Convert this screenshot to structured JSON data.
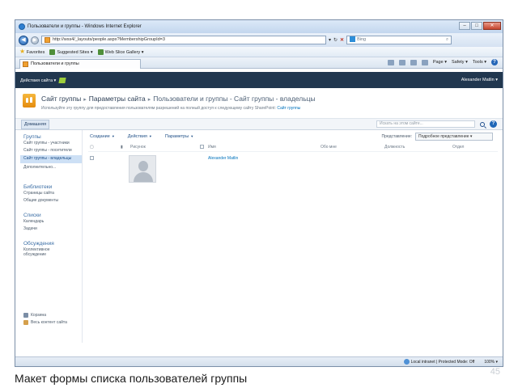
{
  "browser": {
    "title": "Пользователи и группы - Windows Internet Explorer",
    "url": "http://wss4/_layouts/people.aspx?MembershipGroupId=3",
    "search_placeholder": "Bing",
    "favorites": "Favorites",
    "suggested_sites": "Suggested Sites ▾",
    "web_slice": "Web Slice Gallery ▾",
    "tab_title": "Пользователи и группы",
    "cmd_page": "Page ▾",
    "cmd_safety": "Safety ▾",
    "cmd_tools": "Tools ▾",
    "status_zone": "Local intranet | Protected Mode: Off",
    "zoom": "100% ▾"
  },
  "sp": {
    "site_actions": "Действия сайта ▾",
    "user": "Alexander Matlin ▾",
    "breadcrumb": [
      "Сайт группы",
      "Параметры сайта",
      "Пользователи и группы - Сайт группы - владельцы"
    ],
    "description_text": "Используйте эту группу для предоставления пользователям разрешений на полный доступ к следующему сайту SharePoint:",
    "description_link": "Сайт группы",
    "home_tab": "Домашняя",
    "search_placeholder": "Искать на этом сайте..."
  },
  "leftnav": {
    "groups_head": "Группы",
    "groups": [
      "Сайт группы - участники",
      "Сайт группы - посетители",
      "Сайт группы - владельцы",
      "Дополнительно..."
    ],
    "libraries_head": "Библиотеки",
    "libraries": [
      "Страницы сайта",
      "Общие документы"
    ],
    "lists_head": "Списки",
    "lists": [
      "Календарь",
      "Задачи"
    ],
    "discussions_head": "Обсуждения",
    "discussions": [
      "Коллективное обсуждение"
    ],
    "recycle_bin": "Корзина",
    "all_content": "Весь контент сайта"
  },
  "toolbar": {
    "new": "Создание",
    "actions": "Действия",
    "settings": "Параметры",
    "view_label": "Представление:",
    "view_value": "Подробное представление ▾"
  },
  "list": {
    "columns": [
      "Рисунок",
      "Имя",
      "Обо мне",
      "Должность",
      "Отдел"
    ],
    "rows": [
      {
        "name": "Alexander Matlin"
      }
    ]
  },
  "caption": "Макет формы списка пользователей группы",
  "slide_number": "45"
}
